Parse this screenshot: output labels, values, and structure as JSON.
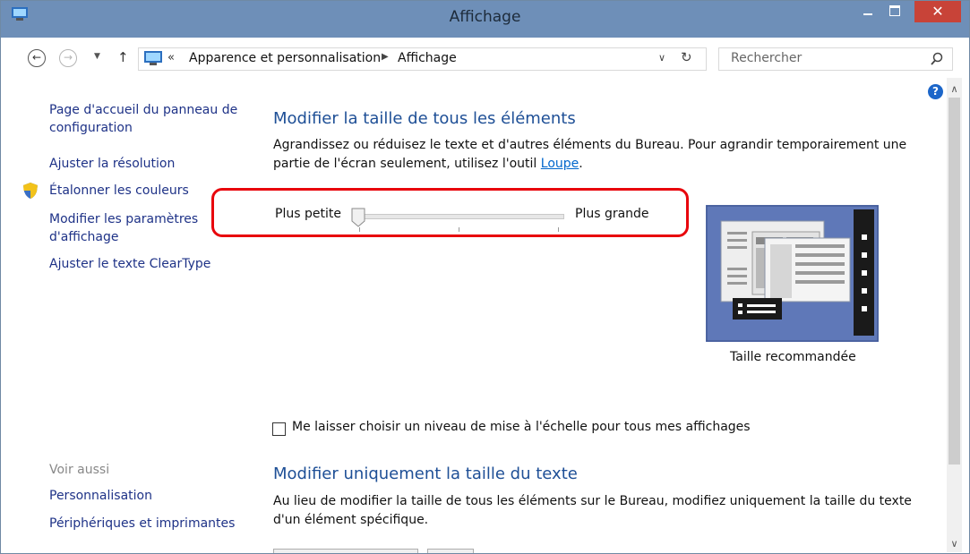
{
  "window": {
    "title": "Affichage"
  },
  "addressbar": {
    "breadcrumb_sep": "«",
    "crumbs": [
      "Apparence et personnalisation",
      "Affichage"
    ],
    "search_placeholder": "Rechercher"
  },
  "sidebar": {
    "home_link": "Page d'accueil du panneau de configuration",
    "links": [
      "Ajuster la résolution",
      "Étalonner les couleurs",
      "Modifier les paramètres d'affichage",
      "Ajuster le texte ClearType"
    ],
    "see_also_heading": "Voir aussi",
    "see_also": [
      "Personnalisation",
      "Périphériques et imprimantes"
    ]
  },
  "main": {
    "section1": {
      "heading": "Modifier la taille de tous les éléments",
      "desc": "Agrandissez ou réduisez le texte et d'autres éléments du Bureau. Pour agrandir temporairement une partie de l'écran seulement, utilisez l'outil",
      "link": "Loupe",
      "period": "."
    },
    "slider": {
      "min_label": "Plus petite",
      "max_label": "Plus grande",
      "value_fraction": 0.0
    },
    "preview_label": "Taille recommandée",
    "checkbox": {
      "label": "Me laisser choisir un niveau de mise à l'échelle pour tous mes affichages",
      "checked": false
    },
    "section2": {
      "heading": "Modifier uniquement la taille du texte",
      "desc": "Au lieu de modifier la taille de tous les éléments sur le Bureau, modifiez uniquement la taille du texte d'un élément spécifique."
    }
  },
  "colors": {
    "titlebar": "#6e8fb8",
    "close": "#c84338",
    "link": "#1e3287",
    "heading": "#1e4f96",
    "highlight": "#e8050c"
  },
  "icons": [
    "control-panel-icon",
    "back-arrow-icon",
    "forward-arrow-icon",
    "up-arrow-icon",
    "refresh-icon",
    "search-icon",
    "shield-icon",
    "help-icon"
  ]
}
